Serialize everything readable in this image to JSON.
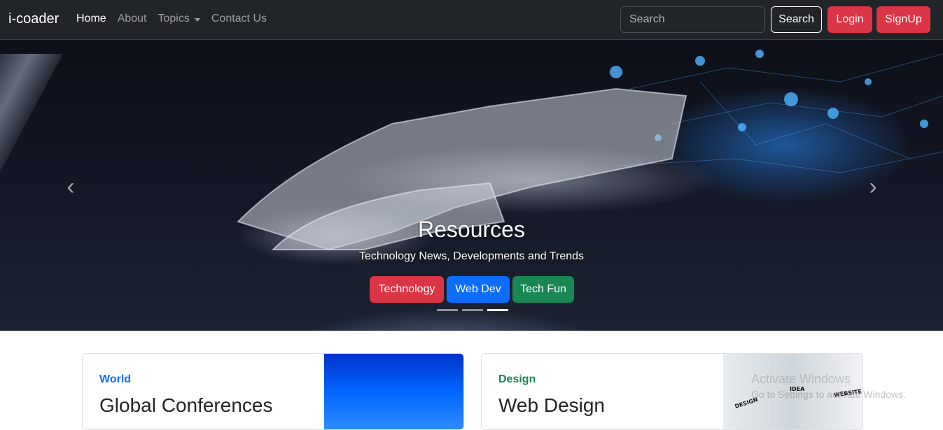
{
  "navbar": {
    "brand": "i-coader",
    "links": [
      {
        "label": "Home"
      },
      {
        "label": "About"
      },
      {
        "label": "Topics"
      },
      {
        "label": "Contact Us"
      }
    ],
    "search_placeholder": "Search",
    "search_button": "Search",
    "login_button": "Login",
    "signup_button": "SignUp"
  },
  "carousel": {
    "title": "Resources",
    "subtitle": "Technology News, Developments and Trends",
    "buttons": [
      "Technology",
      "Web Dev",
      "Tech Fun"
    ],
    "prev_icon": "‹",
    "next_icon": "›",
    "active_slide": 3,
    "total_slides": 3
  },
  "cards": [
    {
      "category": "World",
      "title": "Global Conferences"
    },
    {
      "category": "Design",
      "title": "Web Design",
      "image_labels": [
        "DESIGN",
        "IDEA",
        "WEBSITE"
      ]
    }
  ],
  "watermark": {
    "line1": "Activate Windows",
    "line2": "Go to Settings to activate Windows."
  },
  "colors": {
    "navbar": "#212529",
    "danger": "#dc3545",
    "primary": "#0d6efd",
    "success": "#198754"
  }
}
